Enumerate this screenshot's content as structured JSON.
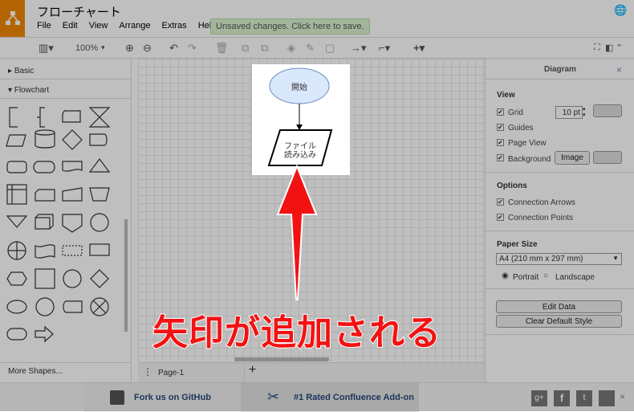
{
  "header": {
    "title": "フローチャート",
    "menu": [
      "File",
      "Edit",
      "View",
      "Arrange",
      "Extras",
      "Help"
    ],
    "unsaved": "Unsaved changes. Click here to save."
  },
  "toolbar": {
    "zoom": "100%"
  },
  "sidebar": {
    "sections": [
      "Basic",
      "Flowchart"
    ],
    "more_shapes": "More Shapes..."
  },
  "diagram": {
    "start_label": "開始",
    "io_label_line1": "ファイル",
    "io_label_line2": "読み込み"
  },
  "pagebar": {
    "page": "Page-1",
    "add": "+"
  },
  "panel": {
    "title": "Diagram",
    "view_heading": "View",
    "grid": "Grid",
    "grid_size": "10 pt",
    "guides": "Guides",
    "page_view": "Page View",
    "background": "Background",
    "image_button": "Image",
    "options_heading": "Options",
    "connection_arrows": "Connection Arrows",
    "connection_points": "Connection Points",
    "paper_size_heading": "Paper Size",
    "paper_size": "A4 (210 mm x 297 mm)",
    "portrait": "Portrait",
    "landscape": "Landscape",
    "edit_data": "Edit Data",
    "clear_style": "Clear Default Style"
  },
  "footer": {
    "github": "Fork us on GitHub",
    "confluence": "#1 Rated Confluence Add-on"
  },
  "annotation": {
    "text": "矢印が追加される",
    "color": "#f31212"
  }
}
